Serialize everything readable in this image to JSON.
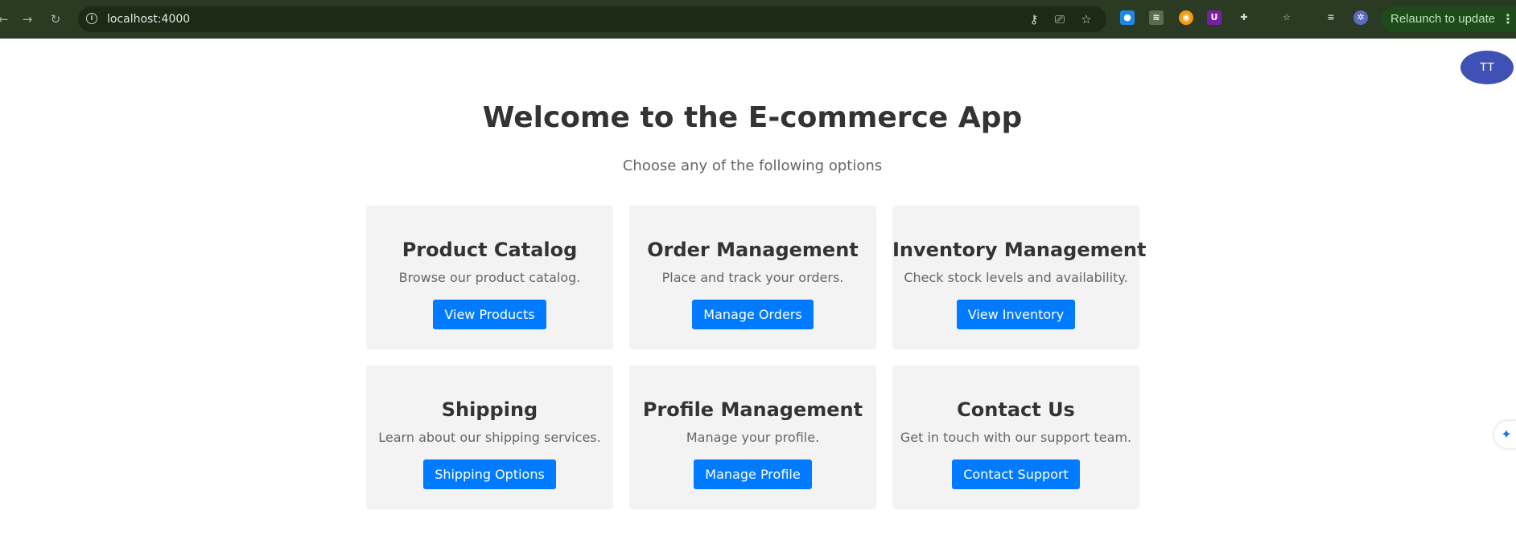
{
  "browser": {
    "url": "localhost:4000",
    "relaunch_label": "Relaunch to update",
    "icons": [
      "back-icon",
      "forward-icon",
      "reload-icon",
      "site-info-icon",
      "key-icon",
      "install-app-icon",
      "bookmark-star-icon",
      "extension-icon",
      "puzzle-icon",
      "reading-list-icon",
      "media-icon",
      "more-vert-icon"
    ],
    "colors": {
      "toolbar": "#2b3a22",
      "omnibox": "#1c2a16",
      "relaunch": "#1f4a1c"
    }
  },
  "avatar": {
    "initials": "TT",
    "color": "#3f51b5"
  },
  "header": {
    "title": "Welcome to the E-commerce App",
    "subtitle": "Choose any of the following options"
  },
  "cards": [
    {
      "title": "Product Catalog",
      "description": "Browse our product catalog.",
      "button": "View Products"
    },
    {
      "title": "Order Management",
      "description": "Place and track your orders.",
      "button": "Manage Orders"
    },
    {
      "title": "Inventory Management",
      "description": "Check stock levels and availability.",
      "button": "View Inventory"
    },
    {
      "title": "Shipping",
      "description": "Learn about our shipping services.",
      "button": "Shipping Options"
    },
    {
      "title": "Profile Management",
      "description": "Manage your profile.",
      "button": "Manage Profile"
    },
    {
      "title": "Contact Us",
      "description": "Get in touch with our support team.",
      "button": "Contact Support"
    }
  ],
  "colors": {
    "button": "#007bff",
    "card": "#f3f3f3",
    "title": "#333333",
    "text": "#666666"
  }
}
